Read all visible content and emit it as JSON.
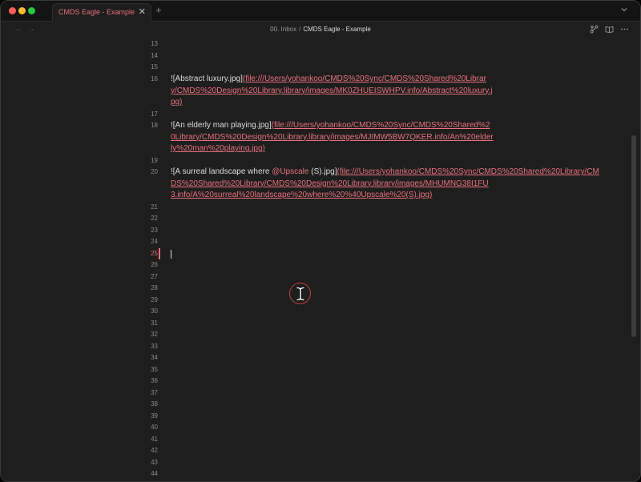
{
  "tab": {
    "title": "CMDS Eagle - Example",
    "close": "✕",
    "new_tab": "+"
  },
  "nav": {
    "back": "←",
    "forward": "→"
  },
  "breadcrumb": {
    "folder": "00. Inbox",
    "separator": "/",
    "current": "CMDS Eagle - Example"
  },
  "icons": {
    "tab_list": "chevron-down-icon",
    "graph": "graph-icon",
    "reading": "book-open-icon",
    "more": "more-horizontal-icon",
    "text_cursor": "text-cursor-icon"
  },
  "colors": {
    "accent": "#e9717d",
    "background": "#1e1e1e",
    "text": "#dcdcdc"
  },
  "editor": {
    "active_line": "25",
    "line_numbers": [
      "13",
      "14",
      "15",
      "16",
      "17",
      "18",
      "19",
      "20",
      "21",
      "22",
      "23",
      "24",
      "25",
      "26",
      "27",
      "28",
      "29",
      "30",
      "31",
      "32",
      "33",
      "34",
      "35",
      "36",
      "37",
      "38",
      "39",
      "40",
      "41",
      "42",
      "43",
      "44"
    ],
    "embeds": [
      {
        "line": "16",
        "alt": "![Abstract luxury.jpg]",
        "link_parts": [
          "(file:///Users/yohankoo/CMDS%20Sync/CMDS%20Shared%20Librar",
          "y/CMDS%20Design%20Library.library/images/MK0ZHUEISWHPV.info/Abstract%20luxury.j",
          "pg)"
        ]
      },
      {
        "line": "18",
        "alt": "![An elderly man playing.jpg]",
        "link_parts": [
          "(file:///Users/yohankoo/CMDS%20Sync/CMDS%20Shared%2",
          "0Library/CMDS%20Design%20Library.library/images/MJIMW5BW7QKER.info/An%20elder",
          "ly%20man%20playing.jpg)"
        ]
      },
      {
        "line": "20",
        "alt_prefix": "![A surreal landscape where ",
        "mention": "@Upscale",
        "alt_suffix": " (S).jpg]",
        "link_parts": [
          "(file:///Users/yohankoo/CMDS%20Sync/CMDS%20Shared%20Library/CM",
          "DS%20Shared%20Library/CMDS%20Design%20Library.library/images/MHUMNG38I1FU",
          "3.info/A%20surreal%20landscape%20where%20%40Upscale%20(S).jpg)"
        ]
      }
    ]
  }
}
